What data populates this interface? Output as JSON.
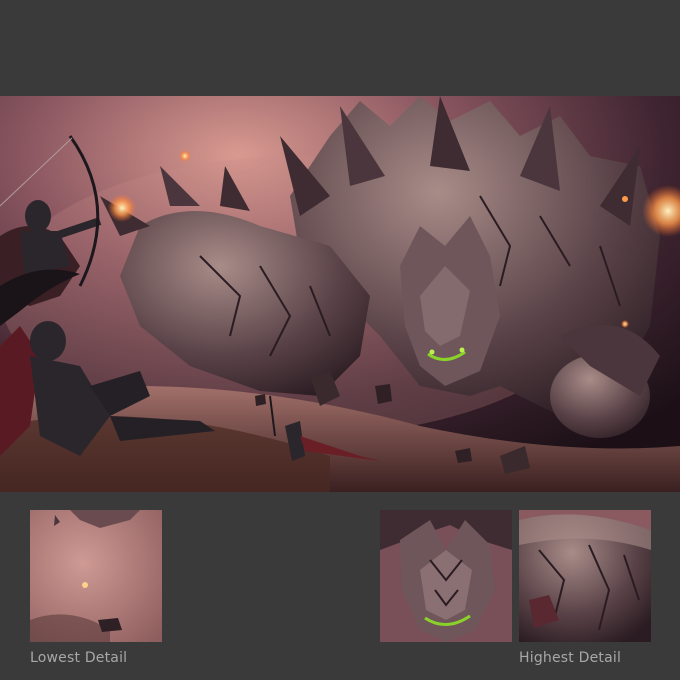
{
  "captions": {
    "lowest": "Lowest Detail",
    "highest": "Highest Detail"
  },
  "colors": {
    "page_background": "#3a3a3a",
    "caption_text": "#a8a8a8",
    "sky_glow": "#c98a86",
    "rock": "#5a4348",
    "rock_highlight": "#a88c88",
    "eye_glow": "#8ad22a",
    "fire": "#ffb36a",
    "knight_armor": "#2a262c",
    "cape": "#5a1a24"
  },
  "illustration": {
    "subjects": [
      "rock-golem",
      "archer-knight",
      "fallen-knight",
      "shield",
      "bow",
      "small-warrior"
    ]
  }
}
